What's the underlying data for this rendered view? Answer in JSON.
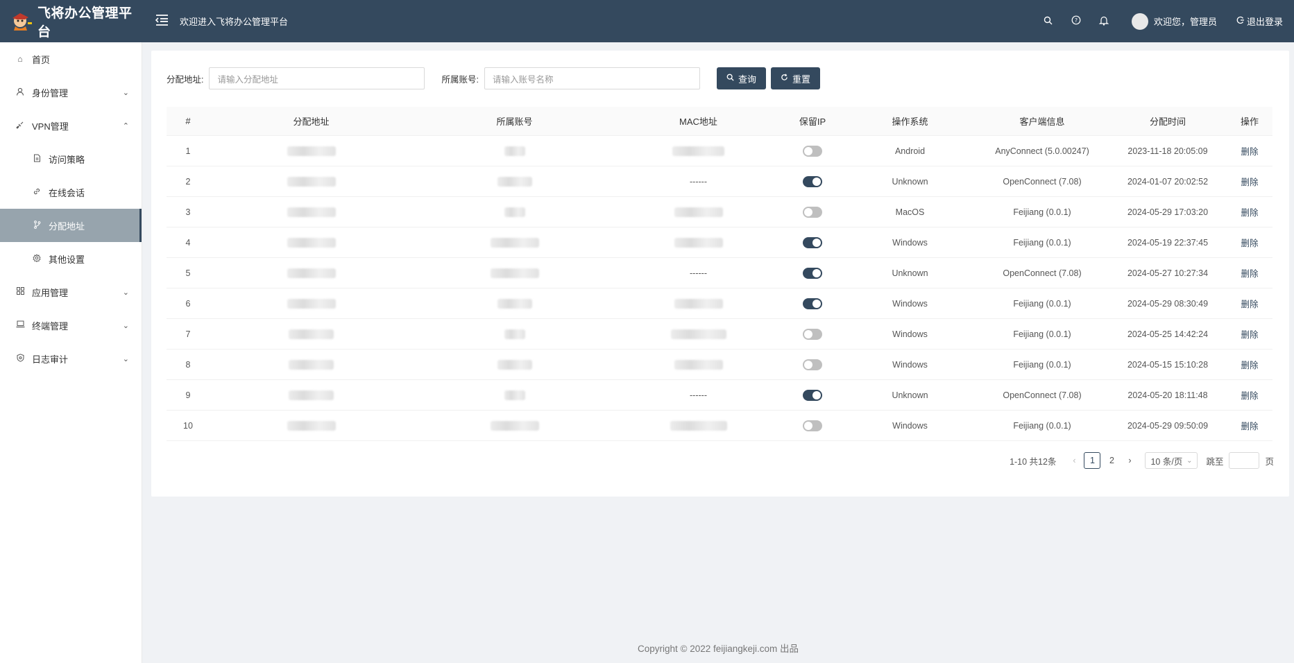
{
  "header": {
    "brand": "飞将办公管理平台",
    "welcome": "欢迎进入飞将办公管理平台",
    "user_greeting": "欢迎您，管理员",
    "logout_label": "退出登录"
  },
  "sidebar": {
    "items": [
      {
        "label": "首页"
      },
      {
        "label": "身份管理"
      },
      {
        "label": "VPN管理"
      },
      {
        "label": "访问策略"
      },
      {
        "label": "在线会话"
      },
      {
        "label": "分配地址"
      },
      {
        "label": "其他设置"
      },
      {
        "label": "应用管理"
      },
      {
        "label": "终端管理"
      },
      {
        "label": "日志审计"
      }
    ]
  },
  "filters": {
    "address_label": "分配地址:",
    "address_placeholder": "请输入分配地址",
    "account_label": "所属账号:",
    "account_placeholder": "请输入账号名称",
    "query_label": "查询",
    "reset_label": "重置"
  },
  "table": {
    "columns": [
      "#",
      "分配地址",
      "所属账号",
      "MAC地址",
      "保留IP",
      "操作系统",
      "客户端信息",
      "分配时间",
      "操作"
    ],
    "rows": [
      {
        "no": "1",
        "mac": "",
        "reserved": false,
        "os": "Android",
        "client": "AnyConnect (5.0.00247)",
        "time": "2023-11-18 20:05:09",
        "action": "删除"
      },
      {
        "no": "2",
        "mac": "------",
        "reserved": true,
        "os": "Unknown",
        "client": "OpenConnect (7.08)",
        "time": "2024-01-07 20:02:52",
        "action": "删除"
      },
      {
        "no": "3",
        "mac": "",
        "reserved": false,
        "os": "MacOS",
        "client": "Feijiang (0.0.1)",
        "time": "2024-05-29 17:03:20",
        "action": "删除"
      },
      {
        "no": "4",
        "mac": "",
        "reserved": true,
        "os": "Windows",
        "client": "Feijiang (0.0.1)",
        "time": "2024-05-19 22:37:45",
        "action": "删除"
      },
      {
        "no": "5",
        "mac": "------",
        "reserved": true,
        "os": "Unknown",
        "client": "OpenConnect (7.08)",
        "time": "2024-05-27 10:27:34",
        "action": "删除"
      },
      {
        "no": "6",
        "mac": "",
        "reserved": true,
        "os": "Windows",
        "client": "Feijiang (0.0.1)",
        "time": "2024-05-29 08:30:49",
        "action": "删除"
      },
      {
        "no": "7",
        "mac": "",
        "reserved": false,
        "os": "Windows",
        "client": "Feijiang (0.0.1)",
        "time": "2024-05-25 14:42:24",
        "action": "删除"
      },
      {
        "no": "8",
        "mac": "",
        "reserved": false,
        "os": "Windows",
        "client": "Feijiang (0.0.1)",
        "time": "2024-05-15 15:10:28",
        "action": "删除"
      },
      {
        "no": "9",
        "mac": "------",
        "reserved": true,
        "os": "Unknown",
        "client": "OpenConnect (7.08)",
        "time": "2024-05-20 18:11:48",
        "action": "删除"
      },
      {
        "no": "10",
        "mac": "",
        "reserved": false,
        "os": "Windows",
        "client": "Feijiang (0.0.1)",
        "time": "2024-05-29 09:50:09",
        "action": "删除"
      }
    ]
  },
  "pagination": {
    "total_text": "1-10 共12条",
    "pages": [
      "1",
      "2"
    ],
    "current": "1",
    "page_size": "10 条/页",
    "jump_label": "跳至",
    "page_unit": "页"
  },
  "footer": {
    "copyright": "Copyright © 2022 feijiangkeji.com 出品"
  },
  "icons": {
    "header": [
      "search-icon",
      "help-icon",
      "bell-icon",
      "logout-icon",
      "menu-fold-icon"
    ],
    "sidebar": [
      "home-icon",
      "user-icon",
      "vpn-icon",
      "file-icon",
      "link-icon",
      "branch-icon",
      "settings-icon",
      "apps-icon",
      "laptop-icon",
      "shield-icon"
    ]
  },
  "colors": {
    "header_bg": "#34495e",
    "accent": "#34495e",
    "active_menu_bg": "#97a4ad"
  }
}
